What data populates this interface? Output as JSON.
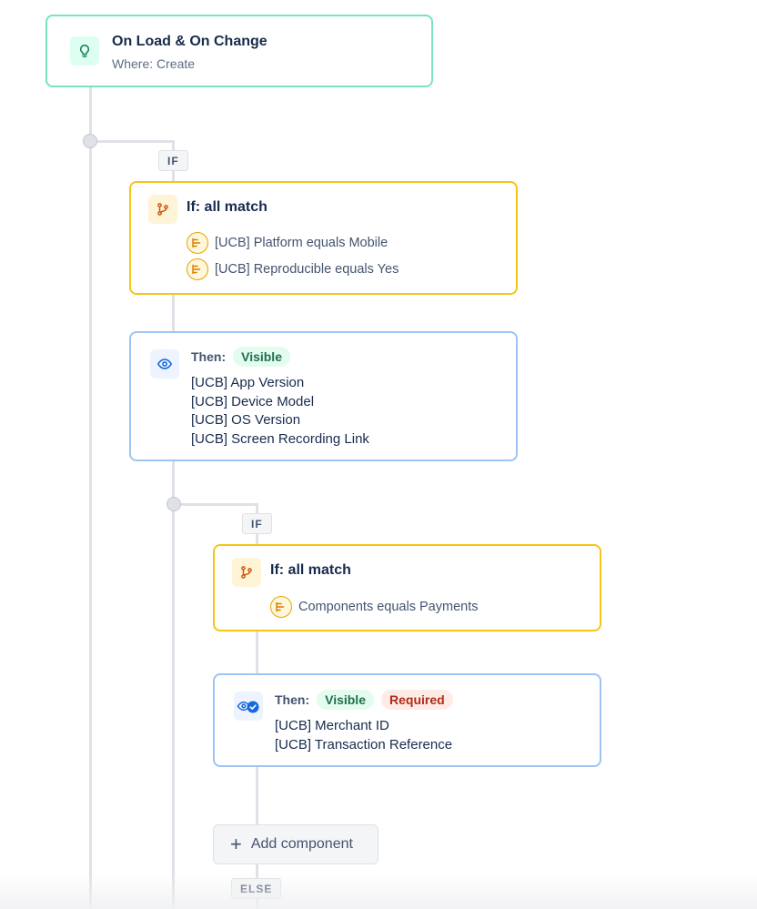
{
  "trigger": {
    "title": "On Load & On Change",
    "subtitle": "Where: Create",
    "icon": "lightbulb-icon"
  },
  "branch1": {
    "if_tag": "IF",
    "condition": {
      "title": "If: all match",
      "icon": "branch-icon",
      "items": [
        "[UCB] Platform equals Mobile",
        "[UCB] Reproducible equals Yes"
      ]
    },
    "action": {
      "then_label": "Then:",
      "badges": [
        "Visible"
      ],
      "icon": "eye-icon",
      "fields": [
        "[UCB] App Version",
        "[UCB] Device Model",
        "[UCB] OS Version",
        "[UCB] Screen Recording Link"
      ]
    }
  },
  "branch2": {
    "if_tag": "IF",
    "condition": {
      "title": "If: all match",
      "icon": "branch-icon",
      "items": [
        "Components equals Payments"
      ]
    },
    "action": {
      "then_label": "Then:",
      "badges": [
        "Visible",
        "Required"
      ],
      "icon": "eye-required-icon",
      "fields": [
        "[UCB] Merchant ID",
        "[UCB] Transaction Reference"
      ]
    },
    "add_component": "Add component",
    "else_tag": "ELSE"
  },
  "colors": {
    "trigger_border": "#79e2c0",
    "condition_border": "#f5c518",
    "action_border": "#9ec3f5",
    "connector": "#dfe1e6"
  }
}
